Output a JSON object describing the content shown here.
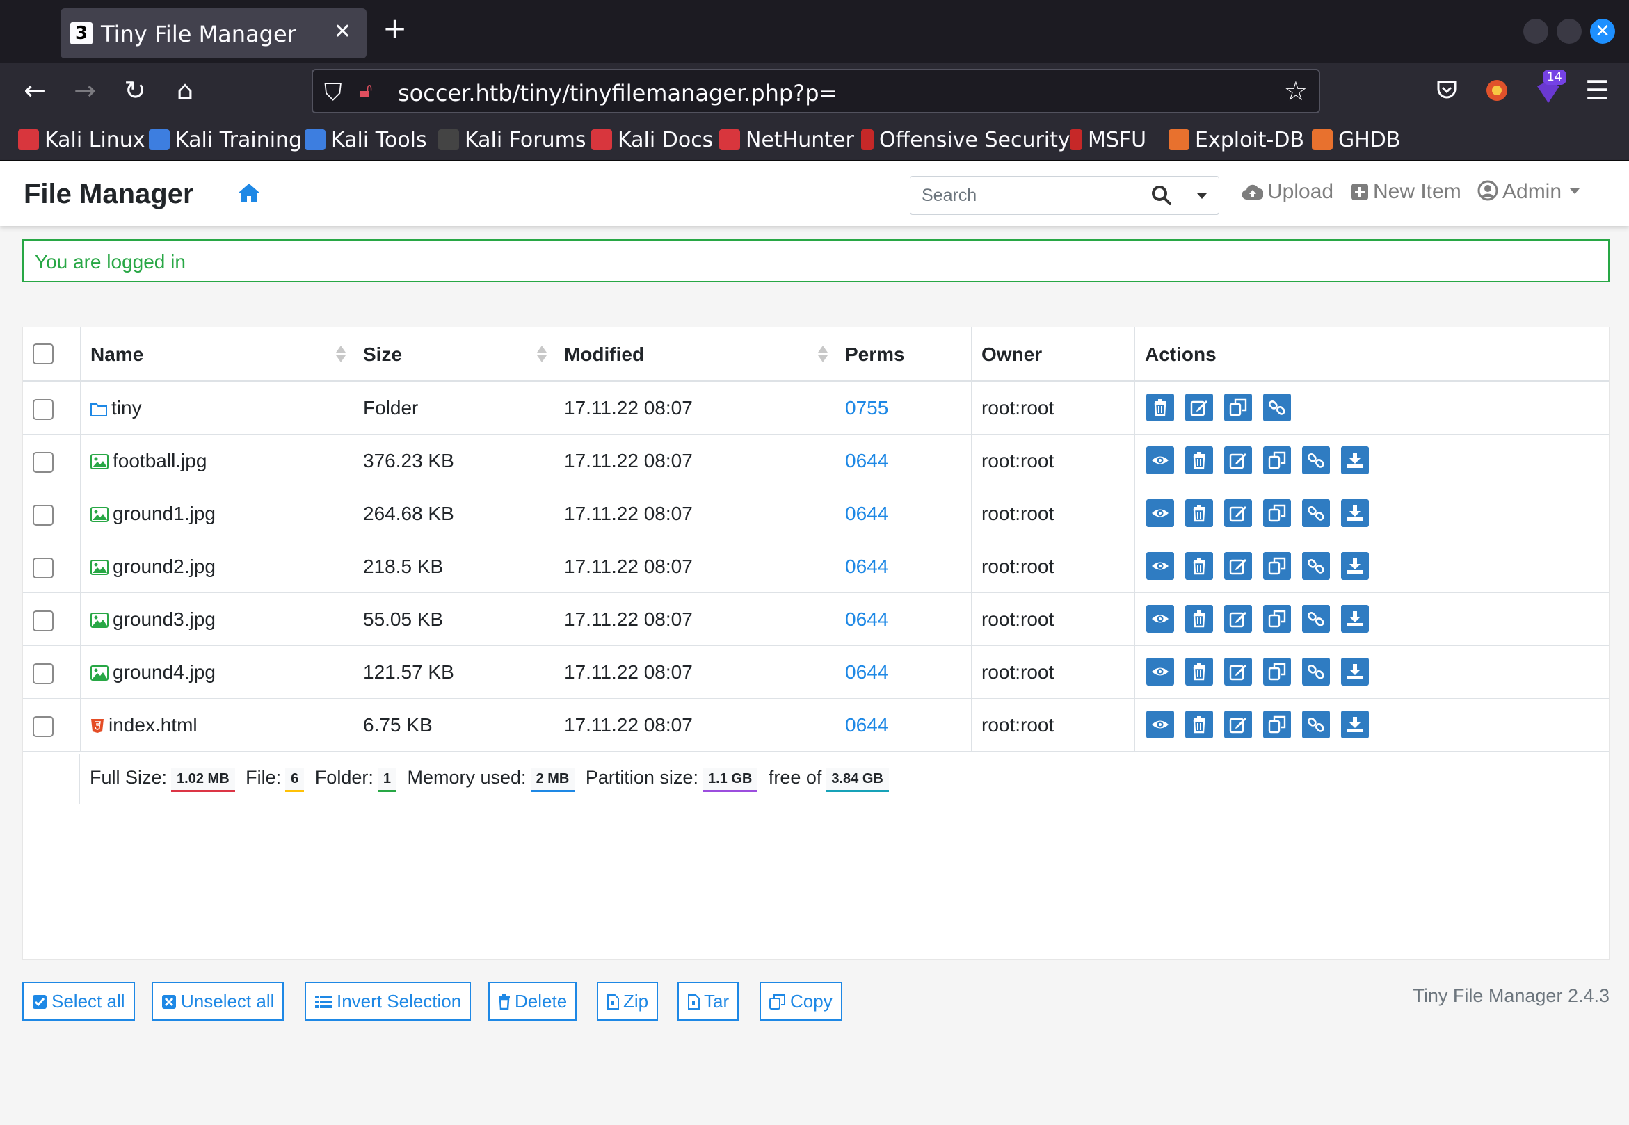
{
  "browser": {
    "tab_title": "Tiny File Manager",
    "tab_favicon": "3",
    "url": "soccer.htb/tiny/tinyfilemanager.php?p=",
    "extension_badge": "14",
    "bookmarks": [
      "Kali Linux",
      "Kali Training",
      "Kali Tools",
      "Kali Forums",
      "Kali Docs",
      "NetHunter",
      "Offensive Security",
      "MSFU",
      "Exploit-DB",
      "GHDB"
    ]
  },
  "header": {
    "brand": "File Manager",
    "search_placeholder": "Search",
    "upload": "Upload",
    "new_item": "New Item",
    "admin": "Admin"
  },
  "alert": "You are logged in",
  "table": {
    "columns": [
      "Name",
      "Size",
      "Modified",
      "Perms",
      "Owner",
      "Actions"
    ],
    "rows": [
      {
        "name": "tiny",
        "type": "folder",
        "size": "Folder",
        "modified": "17.11.22 08:07",
        "perms": "0755",
        "owner": "root:root"
      },
      {
        "name": "football.jpg",
        "type": "image",
        "size": "376.23 KB",
        "modified": "17.11.22 08:07",
        "perms": "0644",
        "owner": "root:root"
      },
      {
        "name": "ground1.jpg",
        "type": "image",
        "size": "264.68 KB",
        "modified": "17.11.22 08:07",
        "perms": "0644",
        "owner": "root:root"
      },
      {
        "name": "ground2.jpg",
        "type": "image",
        "size": "218.5 KB",
        "modified": "17.11.22 08:07",
        "perms": "0644",
        "owner": "root:root"
      },
      {
        "name": "ground3.jpg",
        "type": "image",
        "size": "55.05 KB",
        "modified": "17.11.22 08:07",
        "perms": "0644",
        "owner": "root:root"
      },
      {
        "name": "ground4.jpg",
        "type": "image",
        "size": "121.57 KB",
        "modified": "17.11.22 08:07",
        "perms": "0644",
        "owner": "root:root"
      },
      {
        "name": "index.html",
        "type": "html",
        "size": "6.75 KB",
        "modified": "17.11.22 08:07",
        "perms": "0644",
        "owner": "root:root"
      }
    ],
    "summary": {
      "full_size_label": "Full Size:",
      "full_size": "1.02 MB",
      "file_label": "File:",
      "file": "6",
      "folder_label": "Folder:",
      "folder": "1",
      "memory_label": "Memory used:",
      "memory": "2 MB",
      "partition_label": "Partition size:",
      "partition": "1.1 GB",
      "free_label": "free of",
      "free": "3.84 GB"
    }
  },
  "buttons": {
    "select_all": "Select all",
    "unselect_all": "Unselect all",
    "invert": "Invert Selection",
    "delete": "Delete",
    "zip": "Zip",
    "tar": "Tar",
    "copy": "Copy"
  },
  "version": "Tiny File Manager 2.4.3",
  "colors": {
    "accent": "#1e88e5",
    "action_button": "#2f7cc2",
    "success": "#28a745",
    "badge_full_size": "#dc3545",
    "badge_file": "#ffc107",
    "badge_folder": "#28a745",
    "badge_memory": "#1e88e5",
    "badge_partition": "#9c4dde",
    "badge_free": "#17a2b8"
  }
}
